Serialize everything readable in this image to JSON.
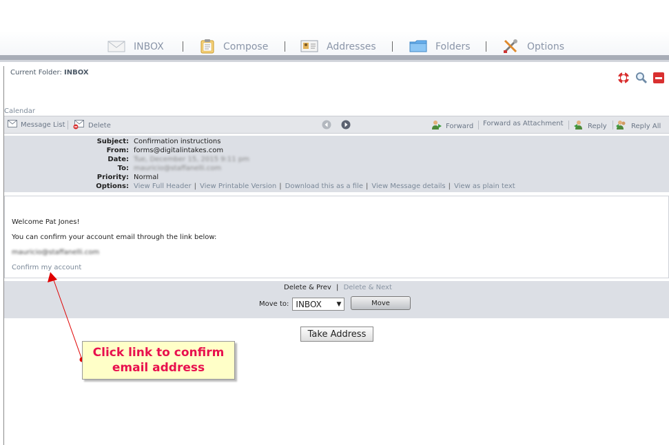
{
  "nav": {
    "inbox": "INBOX",
    "compose": "Compose",
    "addresses": "Addresses",
    "folders": "Folders",
    "options": "Options"
  },
  "current_folder": {
    "label": "Current Folder:",
    "value": "INBOX"
  },
  "calendar": "Calendar",
  "toolbar": {
    "message_list": "Message List",
    "delete": "Delete",
    "forward": "Forward",
    "forward_attachment": "Forward as Attachment",
    "reply": "Reply",
    "reply_all": "Reply All"
  },
  "headers": {
    "subject_label": "Subject:",
    "subject": "Confirmation instructions",
    "from_label": "From:",
    "from": "forms@digitalintakes.com",
    "date_label": "Date:",
    "date": "Tue, December 15, 2015 9:11 pm",
    "to_label": "To:",
    "to": "mauricio@staffanelli.com",
    "priority_label": "Priority:",
    "priority": "Normal",
    "options_label": "Options:",
    "options": [
      "View Full Header",
      "View Printable Version",
      "Download this as a file",
      "View Message details",
      "View as plain text"
    ]
  },
  "body": {
    "greeting": "Welcome Pat Jones!",
    "instruction": "You can confirm your account email through the link below:",
    "email": "mauricio@staffanelli.com",
    "confirm_link": "Confirm my account"
  },
  "bottom": {
    "delete_prev": "Delete & Prev",
    "separator": "|",
    "delete_next": "Delete & Next",
    "move_to_label": "Move to:",
    "move_to_value": "INBOX",
    "move_button": "Move"
  },
  "take_address": "Take Address",
  "callout": {
    "line1": "Click link to confirm",
    "line2": "email address"
  },
  "colors": {
    "callout_text": "#e8104e",
    "callout_bg": "#ffffc8",
    "arrow": "#e00000"
  }
}
